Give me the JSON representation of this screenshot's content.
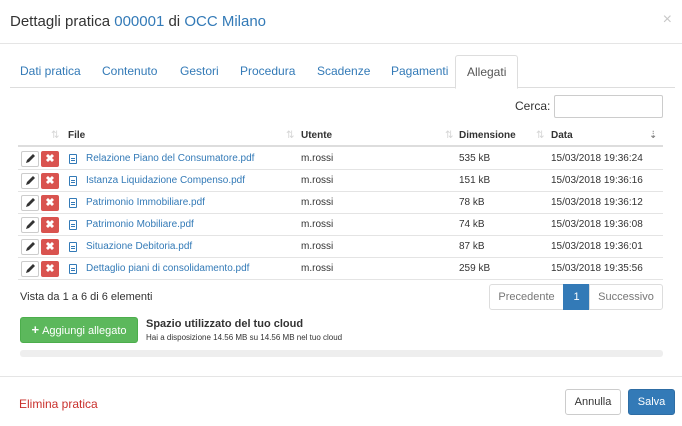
{
  "header": {
    "title_prefix": "Dettagli pratica",
    "number": "000001",
    "connector": "di",
    "organization": "OCC Milano",
    "close_icon": "×"
  },
  "tabs": [
    {
      "label": "Dati pratica"
    },
    {
      "label": "Contenuto"
    },
    {
      "label": "Gestori"
    },
    {
      "label": "Procedura"
    },
    {
      "label": "Scadenze"
    },
    {
      "label": "Pagamenti"
    },
    {
      "label": "Allegati",
      "active": true
    }
  ],
  "search": {
    "label": "Cerca:",
    "value": "",
    "placeholder": ""
  },
  "table": {
    "columns": {
      "file": "File",
      "user": "Utente",
      "size": "Dimensione",
      "date": "Data"
    },
    "rows": [
      {
        "file": "Relazione Piano del Consumatore.pdf",
        "user": "m.rossi",
        "size": "535 kB",
        "date": "15/03/2018 19:36:24"
      },
      {
        "file": "Istanza Liquidazione Compenso.pdf",
        "user": "m.rossi",
        "size": "151 kB",
        "date": "15/03/2018 19:36:16"
      },
      {
        "file": "Patrimonio Immobiliare.pdf",
        "user": "m.rossi",
        "size": "78 kB",
        "date": "15/03/2018 19:36:12"
      },
      {
        "file": "Patrimonio Mobiliare.pdf",
        "user": "m.rossi",
        "size": "74 kB",
        "date": "15/03/2018 19:36:08"
      },
      {
        "file": "Situazione Debitoria.pdf",
        "user": "m.rossi",
        "size": "87 kB",
        "date": "15/03/2018 19:36:01"
      },
      {
        "file": "Dettaglio piani di consolidamento.pdf",
        "user": "m.rossi",
        "size": "259 kB",
        "date": "15/03/2018 19:35:56"
      }
    ]
  },
  "info": "Vista da 1 a 6 di 6 elementi",
  "pagination": {
    "prev": "Precedente",
    "current": "1",
    "next": "Successivo"
  },
  "upload": {
    "button_label": "Aggiungi allegato",
    "plus": "+"
  },
  "cloud": {
    "title": "Spazio utilizzato del tuo cloud",
    "subtitle": "Hai a disposizione 14.56 MB su 14.56 MB nel tuo cloud",
    "used_fraction": 0
  },
  "footer": {
    "delete_label": "Elimina pratica",
    "cancel_label": "Annulla",
    "save_label": "Salva"
  },
  "colors": {
    "link": "#337ab7",
    "danger": "#d9534f",
    "success": "#5cb85c",
    "primary": "#337ab7",
    "delete_text": "#c9302c"
  }
}
